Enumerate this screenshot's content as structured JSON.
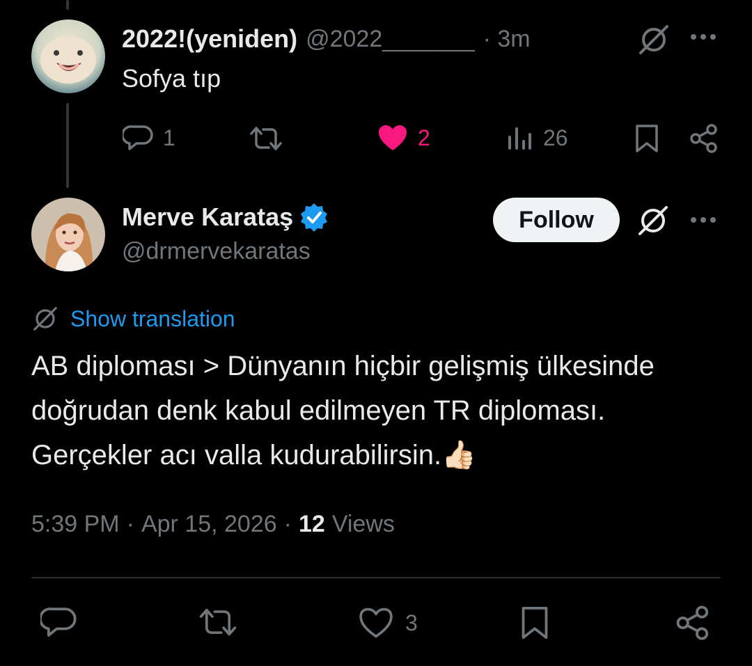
{
  "reply": {
    "display_name": "2022!(yeniden)",
    "handle": "@2022_______",
    "time": "· 3m",
    "text": "Sofya tıp",
    "actions": {
      "replies": "1",
      "likes": "2",
      "views": "26"
    },
    "liked": true
  },
  "main_tweet": {
    "display_name": "Merve Karataş",
    "handle": "@drmervekaratas",
    "verified": true,
    "follow_label": "Follow",
    "show_translation": "Show translation",
    "text": "AB diploması > Dünyanın hiçbir gelişmiş ülkesinde doğrudan denk kabul edilmeyen TR diploması. Gerçekler acı valla kudurabilirsin.",
    "emoji": "👍🏻",
    "meta": {
      "time": "5:39 PM",
      "separator": "·",
      "date": "Apr 15, 2026",
      "views_count": "12",
      "views_label": "Views"
    },
    "actions": {
      "likes": "3"
    }
  },
  "colors": {
    "background": "#000000",
    "text": "#e7e9ea",
    "muted": "#71767b",
    "link": "#1d9bf0",
    "like": "#f91880",
    "verified": "#1d9bf0"
  },
  "icons": [
    "grok-icon",
    "more-icon",
    "reply-icon",
    "retweet-icon",
    "heart-icon",
    "views-icon",
    "bookmark-icon",
    "share-icon",
    "verified-badge-icon",
    "translate-icon"
  ]
}
